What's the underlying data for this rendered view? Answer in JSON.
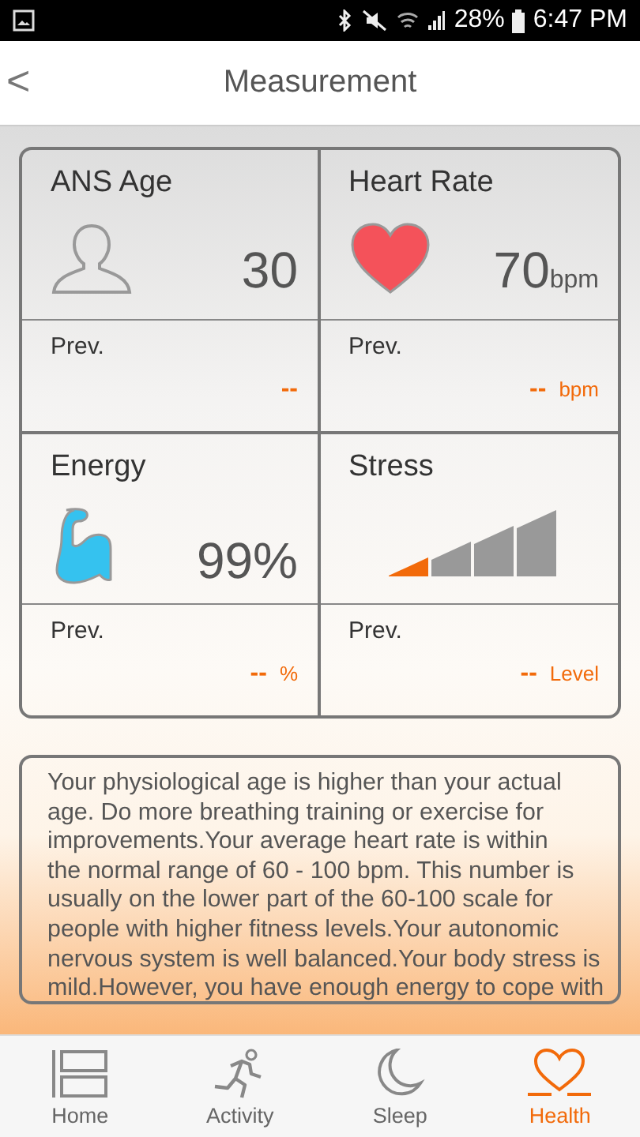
{
  "status_bar": {
    "battery": "28%",
    "time": "6:47 PM"
  },
  "header": {
    "back": "<",
    "title": "Measurement"
  },
  "metrics": [
    {
      "kind": "age",
      "title": "ANS Age",
      "value": "30",
      "prev_label": "Prev.",
      "prev_value": "--"
    },
    {
      "kind": "heart",
      "title": "Heart Rate",
      "value": "70",
      "unit": "bpm",
      "prev_label": "Prev.",
      "prev_value": "--",
      "prev_unit": "bpm"
    },
    {
      "kind": "energy",
      "title": "Energy",
      "value": "99%",
      "prev_label": "Prev.",
      "prev_value": "--",
      "prev_unit": "%"
    },
    {
      "kind": "stress",
      "title": "Stress",
      "level": 0.25,
      "prev_label": "Prev.",
      "prev_value": "--",
      "prev_unit": "Level"
    }
  ],
  "summary": "Your physiological age is higher than your actual\nage. Do more breathing training or exercise for\nimprovements.Your average heart rate is within\nthe normal range of 60 - 100 bpm. This number is\nusually on the lower part of the 60-100 scale for\npeople with higher fitness levels.Your autonomic\nnervous system is well balanced.Your body stress is\nmild.However, you have enough energy to cope with",
  "tabs": [
    {
      "kind": "home",
      "label": "Home",
      "selected": false
    },
    {
      "kind": "activity",
      "label": "Activity",
      "selected": false
    },
    {
      "kind": "sleep",
      "label": "Sleep",
      "selected": false
    },
    {
      "kind": "health",
      "label": "Health",
      "selected": true
    }
  ]
}
